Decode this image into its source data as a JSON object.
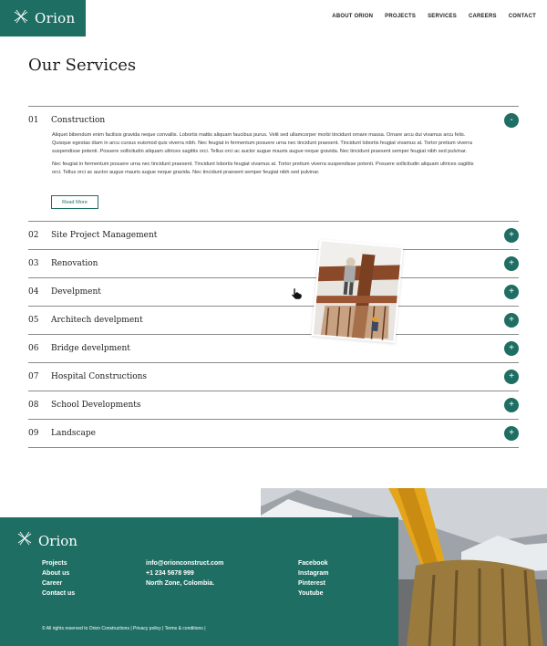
{
  "brand": {
    "name": "Orion",
    "color": "#1e6e63",
    "icon": "orion-knot-icon"
  },
  "nav": [
    "ABOUT ORION",
    "PROJECTS",
    "SERVICES",
    "CAREERS",
    "CONTACT"
  ],
  "page_title": "Our Services",
  "services": [
    {
      "num": "01",
      "title": "Construction",
      "expanded": true,
      "toggle": "-"
    },
    {
      "num": "02",
      "title": "Site Project Management",
      "toggle": "+"
    },
    {
      "num": "03",
      "title": "Renovation",
      "toggle": "+"
    },
    {
      "num": "04",
      "title": "Develpment",
      "toggle": "+"
    },
    {
      "num": "05",
      "title": "Architech develpment",
      "toggle": "+"
    },
    {
      "num": "06",
      "title": "Bridge develpment",
      "toggle": "+"
    },
    {
      "num": "07",
      "title": "Hospital Constructions",
      "toggle": "+"
    },
    {
      "num": "08",
      "title": "School Developments",
      "toggle": "+"
    },
    {
      "num": "09",
      "title": "Landscape",
      "toggle": "+"
    }
  ],
  "expanded_body": {
    "para1": "Aliquet bibendum enim facilisis gravida neque convallis. Lobortis mattis aliquam faucibus purus. Velit sed ullamcorper morbi tincidunt ornare massa. Ornare arcu dui vivamus arcu felis. Quisque egestas diam in arcu cursus euismod quis viverra nibh. Nec feugiat in fermentum posuere urna nec tincidunt praesent. Tincidunt lobortis feugiat vivamus at. Tortor pretium viverra suspendisse potenti. Posuere sollicitudin aliquam ultrices sagittis orci. Tellus orci ac auctor augue mauris augue neque gravida. Nec tincidunt praesent semper feugiat nibh sed pulvinar.",
    "para2": "Nec feugiat in fermentum posuere urna nec tincidunt praesent. Tincidunt lobortis feugiat vivamus at. Tortor pretium viverra suspendisse potenti. Posuere sollicitudin aliquam ultrices sagittis orci. Tellus orci ac auctor augue mauris augue neque gravida. Nec tincidunt praesent semper feugiat nibh sed pulvinar.",
    "read_more": "Read More"
  },
  "footer": {
    "links": [
      "Projects",
      "About us",
      "Career",
      "Contact us"
    ],
    "contact": [
      "info@orionconstruct.com",
      "+1 234 5678 999",
      "North Zone, Colombia."
    ],
    "social": [
      "Facebook",
      "Instagram",
      "Pinterest",
      "Youtube"
    ],
    "copyright": "© All rights reserved to Orion Constructions | Privacy policy | Terms & conditions |"
  }
}
